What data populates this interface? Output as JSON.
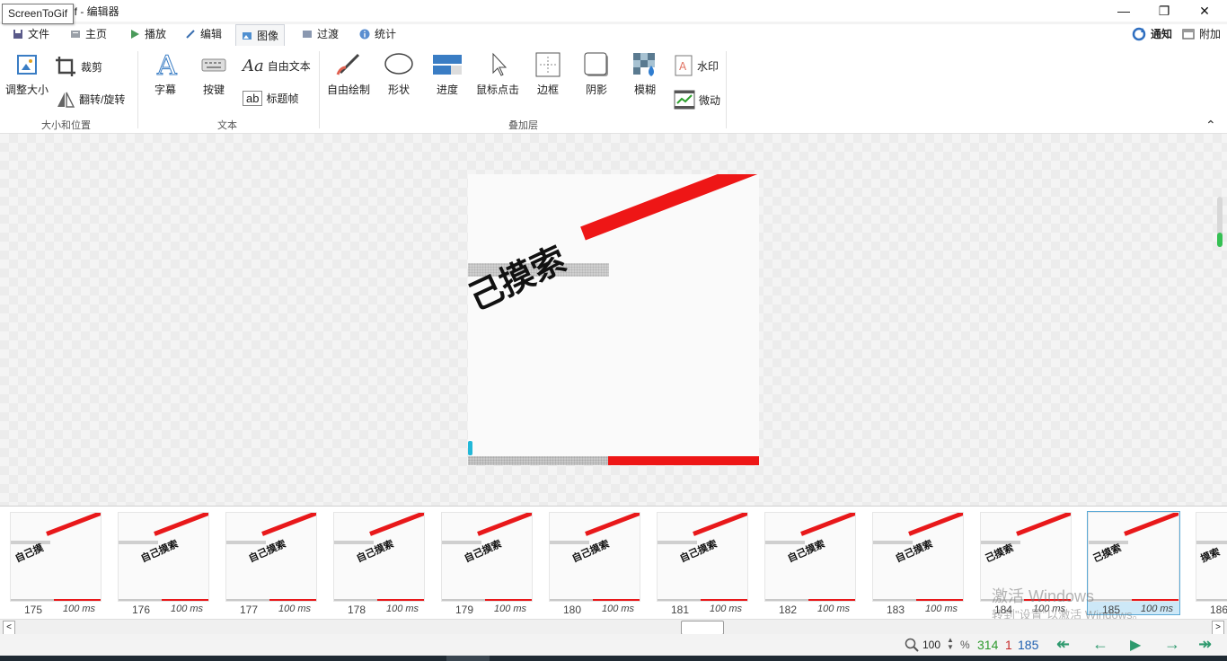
{
  "window": {
    "tooltip": "ScreenToGif",
    "title_suffix": "if - 编辑器"
  },
  "menu": {
    "tabs": [
      {
        "label": "文件",
        "icon": "save-icon"
      },
      {
        "label": "主页",
        "icon": "home-icon"
      },
      {
        "label": "播放",
        "icon": "play-icon"
      },
      {
        "label": "编辑",
        "icon": "pencil-icon"
      },
      {
        "label": "图像",
        "icon": "image-icon",
        "active": true
      },
      {
        "label": "过渡",
        "icon": "transition-icon"
      },
      {
        "label": "统计",
        "icon": "info-icon"
      }
    ],
    "notify": "通知",
    "extras": "附加"
  },
  "ribbon": {
    "size_group": {
      "label": "大小和位置",
      "resize": "调整大小",
      "crop": "裁剪",
      "flip": "翻转/旋转"
    },
    "text_group": {
      "label": "文本",
      "caption": "字幕",
      "keys": "按键",
      "free_text": "自由文本",
      "title_frame": "标题帧"
    },
    "overlay_group": {
      "label": "叠加层",
      "free_draw": "自由绘制",
      "shape": "形状",
      "progress": "进度",
      "mouse_clicks": "鼠标点击",
      "border": "边框",
      "shadow": "阴影",
      "blur": "模糊",
      "watermark": "水印",
      "cinemagraph": "微动"
    }
  },
  "canvas": {
    "frame_text": "己摸索"
  },
  "timeline": {
    "frames": [
      {
        "n": "175",
        "ms": "100 ms",
        "t": "自己摸"
      },
      {
        "n": "176",
        "ms": "100 ms",
        "t": "自己摸索"
      },
      {
        "n": "177",
        "ms": "100 ms",
        "t": "自己摸索"
      },
      {
        "n": "178",
        "ms": "100 ms",
        "t": "自己摸索"
      },
      {
        "n": "179",
        "ms": "100 ms",
        "t": "自己摸索"
      },
      {
        "n": "180",
        "ms": "100 ms",
        "t": "自己摸索"
      },
      {
        "n": "181",
        "ms": "100 ms",
        "t": "自己摸索"
      },
      {
        "n": "182",
        "ms": "100 ms",
        "t": "自己摸索"
      },
      {
        "n": "183",
        "ms": "100 ms",
        "t": "自己摸索"
      },
      {
        "n": "184",
        "ms": "100 ms",
        "t": "己摸索"
      },
      {
        "n": "185",
        "ms": "100 ms",
        "t": "己摸索",
        "selected": true
      },
      {
        "n": "186",
        "ms": "",
        "t": "摸索"
      }
    ],
    "watermark_line1": "激活 Windows",
    "watermark_line2": "转到\"设置\"以激活 Windows。"
  },
  "status": {
    "zoom": "100",
    "percent": "%",
    "total": "314",
    "selected": "1",
    "current": "185"
  },
  "colors": {
    "accent_red": "#e8181a",
    "total_green": "#2e9a2e",
    "selected_red": "#c62828",
    "current_blue": "#1f5fb0",
    "nav_green": "#2e9a6e"
  }
}
